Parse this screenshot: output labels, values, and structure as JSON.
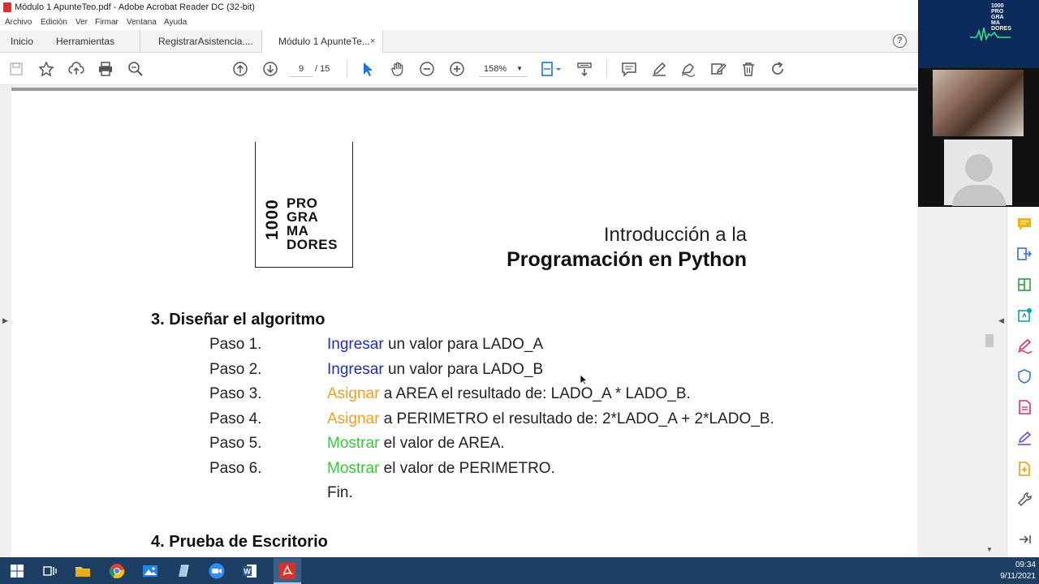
{
  "window": {
    "title": "Módulo 1 ApunteTeo.pdf - Adobe Acrobat Reader DC (32-bit)"
  },
  "menu": [
    "Archivo",
    "Edición",
    "Ver",
    "Firmar",
    "Ventana",
    "Ayuda"
  ],
  "tabs": {
    "home": "Inicio",
    "tools": "Herramientas",
    "doc1": "RegistrarAsistencia....",
    "doc2": "Módulo 1 ApunteTe...",
    "close": "×",
    "help": "?"
  },
  "toolbar": {
    "current_page": "9",
    "total_pages": "/ 15",
    "zoom": "158%"
  },
  "document": {
    "logo_number": "1000",
    "logo_lines": [
      "PRO",
      "GRA",
      "MA",
      "DORES"
    ],
    "title_line1": "Introducción a la",
    "title_line2": "Programación en Python",
    "section3": "3. Diseñar el algoritmo",
    "steps": [
      {
        "label": "Paso 1.",
        "verb": "Ingresar",
        "rest": " un valor para LADO_A",
        "color": "blue"
      },
      {
        "label": "Paso 2.",
        "verb": "Ingresar",
        "rest": " un valor para LADO_B",
        "color": "blue"
      },
      {
        "label": "Paso 3.",
        "verb": "Asignar",
        "rest": " a AREA el resultado de: LADO_A * LADO_B.",
        "color": "orange"
      },
      {
        "label": "Paso 4.",
        "verb": "Asignar",
        "rest": " a PERIMETRO el resultado de: 2*LADO_A + 2*LADO_B.",
        "color": "orange"
      },
      {
        "label": "Paso 5.",
        "verb": "Mostrar",
        "rest": " el valor de AREA.",
        "color": "green"
      },
      {
        "label": "Paso 6.",
        "verb": "Mostrar",
        "rest": " el valor de PERIMETRO.",
        "color": "green"
      }
    ],
    "end": "Fin.",
    "section4": "4. Prueba de Escritorio"
  },
  "video": {
    "brand_lines": [
      "1000",
      "PRO",
      "GRA",
      "MA",
      "DORES"
    ]
  },
  "taskbar": {
    "time": "09:34",
    "date": "9/11/2021"
  },
  "colors": {
    "blue_verb": "#1f2fb0",
    "orange_verb": "#f0a020",
    "green_verb": "#33cc33",
    "taskbar": "#1d3f63"
  }
}
